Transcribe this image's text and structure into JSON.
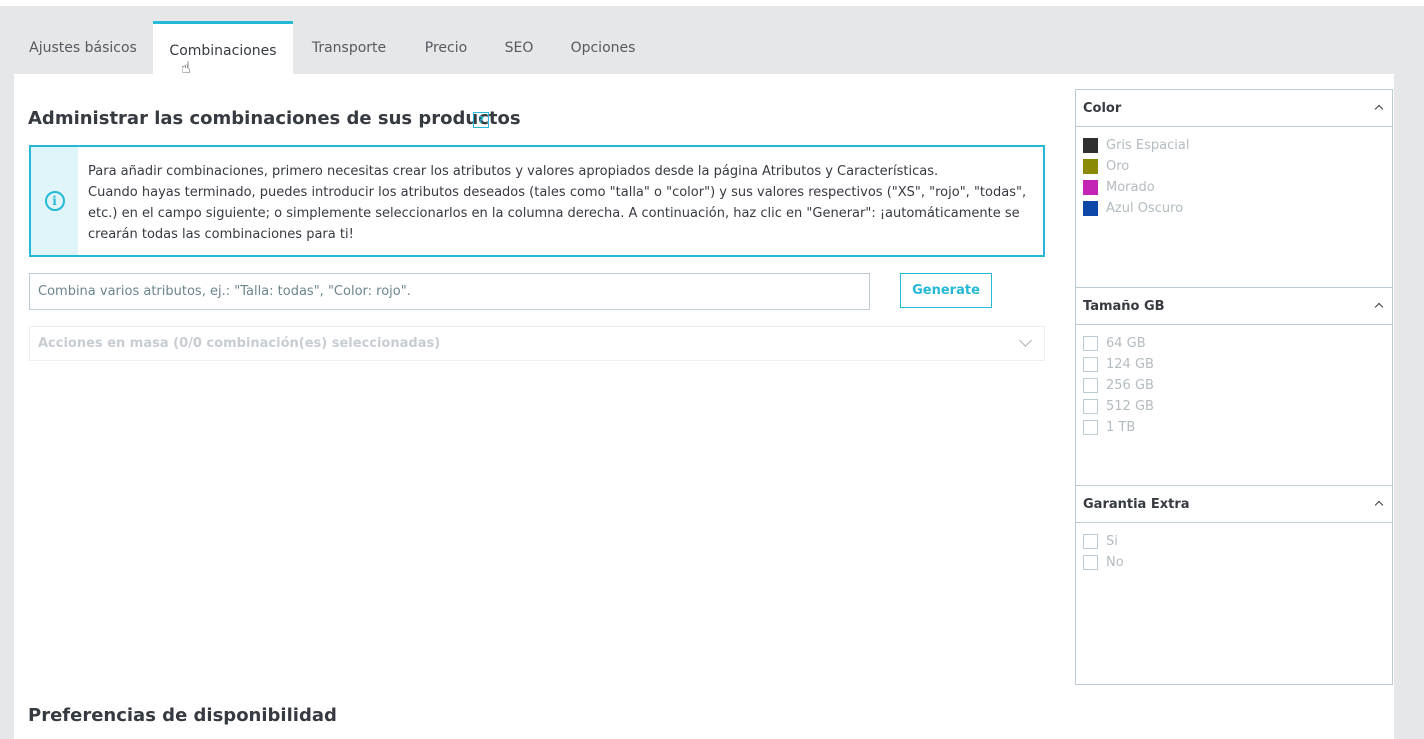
{
  "tabs": [
    {
      "label": "Ajustes básicos",
      "active": false
    },
    {
      "label": "Combinaciones",
      "active": true
    },
    {
      "label": "Transporte",
      "active": false
    },
    {
      "label": "Precio",
      "active": false
    },
    {
      "label": "SEO",
      "active": false
    },
    {
      "label": "Opciones",
      "active": false
    }
  ],
  "main": {
    "title": "Administrar las combinaciones de sus productos",
    "help_icon": "?",
    "info_lines": [
      "Para añadir combinaciones, primero necesitas crear los atributos y valores apropiados desde la página Atributos y Características.",
      "Cuando hayas terminado, puedes introducir los atributos deseados (tales como \"talla\" o \"color\") y sus valores respectivos (\"XS\", \"rojo\", \"todas\", etc.) en el campo siguiente; o simplemente seleccionarlos en la columna derecha. A continuación, haz clic en \"Generar\": ¡automáticamente se crearán todas las combinaciones para ti!"
    ],
    "input_placeholder": "Combina varios atributos, ej.: \"Talla: todas\", \"Color: rojo\".",
    "generate_label": "Generate",
    "bulk_label": "Acciones en masa (0/0 combinación(es) seleccionadas)",
    "availability_title": "Preferencias de disponibilidad"
  },
  "attribute_groups": [
    {
      "title": "Color",
      "type": "color",
      "items": [
        {
          "label": "Gris Espacial",
          "color": "#2f2f2f"
        },
        {
          "label": "Oro",
          "color": "#8b8a06"
        },
        {
          "label": "Morado",
          "color": "#c424b5"
        },
        {
          "label": "Azul Oscuro",
          "color": "#0d47a8"
        }
      ]
    },
    {
      "title": "Tamaño GB",
      "type": "checkbox",
      "items": [
        {
          "label": "64 GB"
        },
        {
          "label": "124 GB"
        },
        {
          "label": "256 GB"
        },
        {
          "label": "512 GB"
        },
        {
          "label": "1 TB"
        }
      ]
    },
    {
      "title": "Garantia Extra",
      "type": "checkbox",
      "items": [
        {
          "label": "Si"
        },
        {
          "label": "No"
        }
      ]
    }
  ],
  "colors": {
    "accent": "#25b9d7",
    "border": "#bbcdd2",
    "muted_text": "#b3bcc1"
  }
}
